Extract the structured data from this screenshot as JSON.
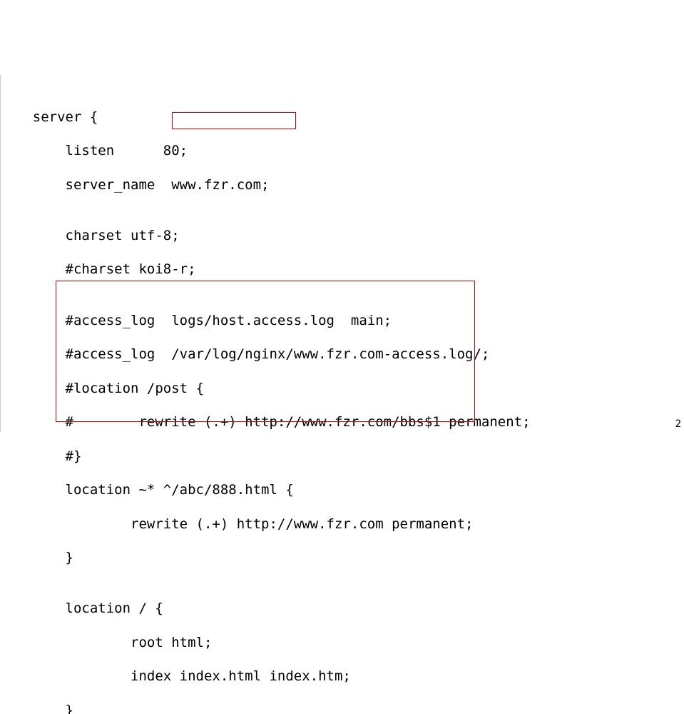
{
  "code": {
    "l0": "    server {",
    "l1": "        listen      80;",
    "l2": "        server_name  www.fzr.com;",
    "l3": "",
    "l4": "        charset utf-8;",
    "l5": "        #charset koi8-r;",
    "l6": "",
    "l7": "        #access_log  logs/host.access.log  main;",
    "l8": "        #access_log  /var/log/nginx/www.fzr.com-access.log/;",
    "l9": "        #location /post {",
    "l10": "        #        rewrite (.+) http://www.fzr.com/bbs$1 permanent;",
    "l11": "        #}",
    "l12": "        location ~* ^/abc/888.html {",
    "l13": "                rewrite (.+) http://www.fzr.com permanent;",
    "l14": "        }",
    "l15": "",
    "l16": "        location / {",
    "l17": "                root html;",
    "l18": "                index index.html index.htm;",
    "l19": "        }"
  },
  "page_number": "2"
}
